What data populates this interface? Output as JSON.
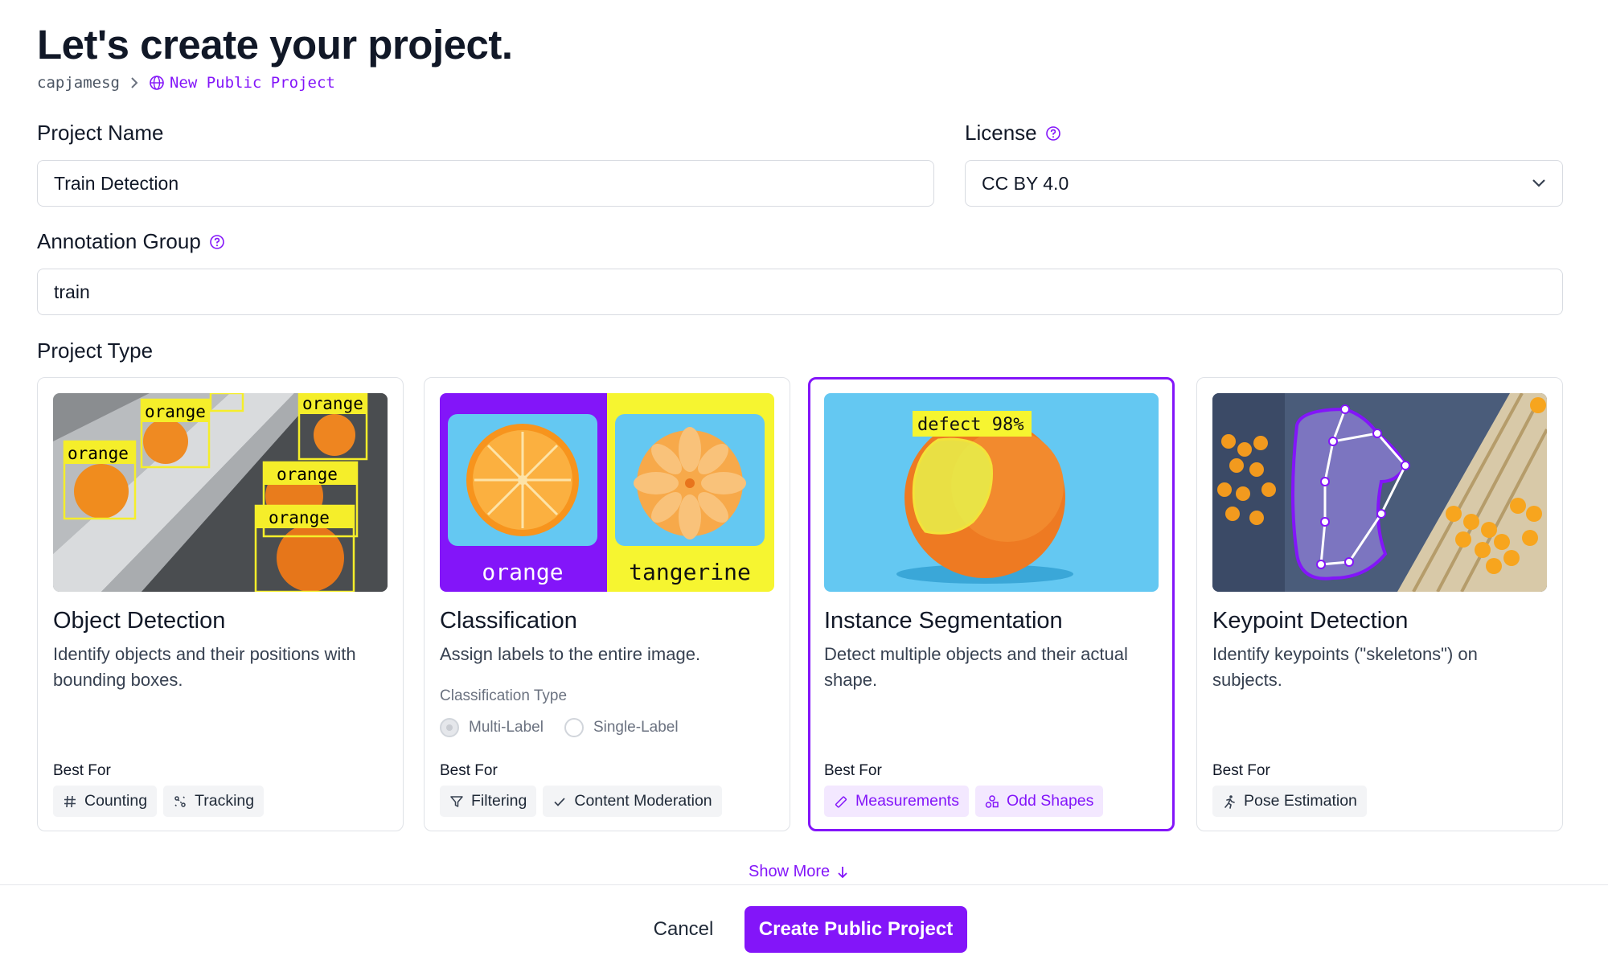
{
  "page": {
    "title": "Let's create your project.",
    "breadcrumb": {
      "owner": "capjamesg",
      "project": "New Public Project",
      "project_icon": "globe-icon"
    }
  },
  "form": {
    "project_name": {
      "label": "Project Name",
      "value": "Train Detection"
    },
    "license": {
      "label": "License",
      "value": "CC BY 4.0"
    },
    "annotation_group": {
      "label": "Annotation Group",
      "value": "train"
    },
    "project_type_label": "Project Type"
  },
  "cards": [
    {
      "title": "Object Detection",
      "description": "Identify objects and their positions with bounding boxes.",
      "best_for_label": "Best For",
      "image_labels": [
        "orange",
        "orange",
        "orange",
        "orange",
        "orange"
      ],
      "tags": [
        {
          "icon": "hash-icon",
          "label": "Counting"
        },
        {
          "icon": "tracking-icon",
          "label": "Tracking"
        }
      ]
    },
    {
      "title": "Classification",
      "description": "Assign labels to the entire image.",
      "best_for_label": "Best For",
      "image_labels": [
        "orange",
        "tangerine"
      ],
      "classification_type_label": "Classification Type",
      "options": [
        "Multi-Label",
        "Single-Label"
      ],
      "selected_option": "Multi-Label",
      "tags": [
        {
          "icon": "filter-icon",
          "label": "Filtering"
        },
        {
          "icon": "check-icon",
          "label": "Content Moderation"
        }
      ]
    },
    {
      "title": "Instance Segmentation",
      "description": "Detect multiple objects and their actual shape.",
      "best_for_label": "Best For",
      "image_labels": [
        "defect 98%"
      ],
      "selected": true,
      "tags": [
        {
          "icon": "ruler-icon",
          "label": "Measurements"
        },
        {
          "icon": "shapes-icon",
          "label": "Odd Shapes"
        }
      ]
    },
    {
      "title": "Keypoint Detection",
      "description": "Identify keypoints (\"skeletons\") on subjects.",
      "best_for_label": "Best For",
      "tags": [
        {
          "icon": "person-running-icon",
          "label": "Pose Estimation"
        }
      ]
    }
  ],
  "footer": {
    "show_more": "Show More",
    "cancel": "Cancel",
    "create": "Create Public Project"
  },
  "colors": {
    "accent": "#8315f9",
    "text": "#111827",
    "border": "#d8dbe1",
    "tag_bg": "#f3f4f6",
    "purple_tag_bg": "#f3e8ff"
  }
}
